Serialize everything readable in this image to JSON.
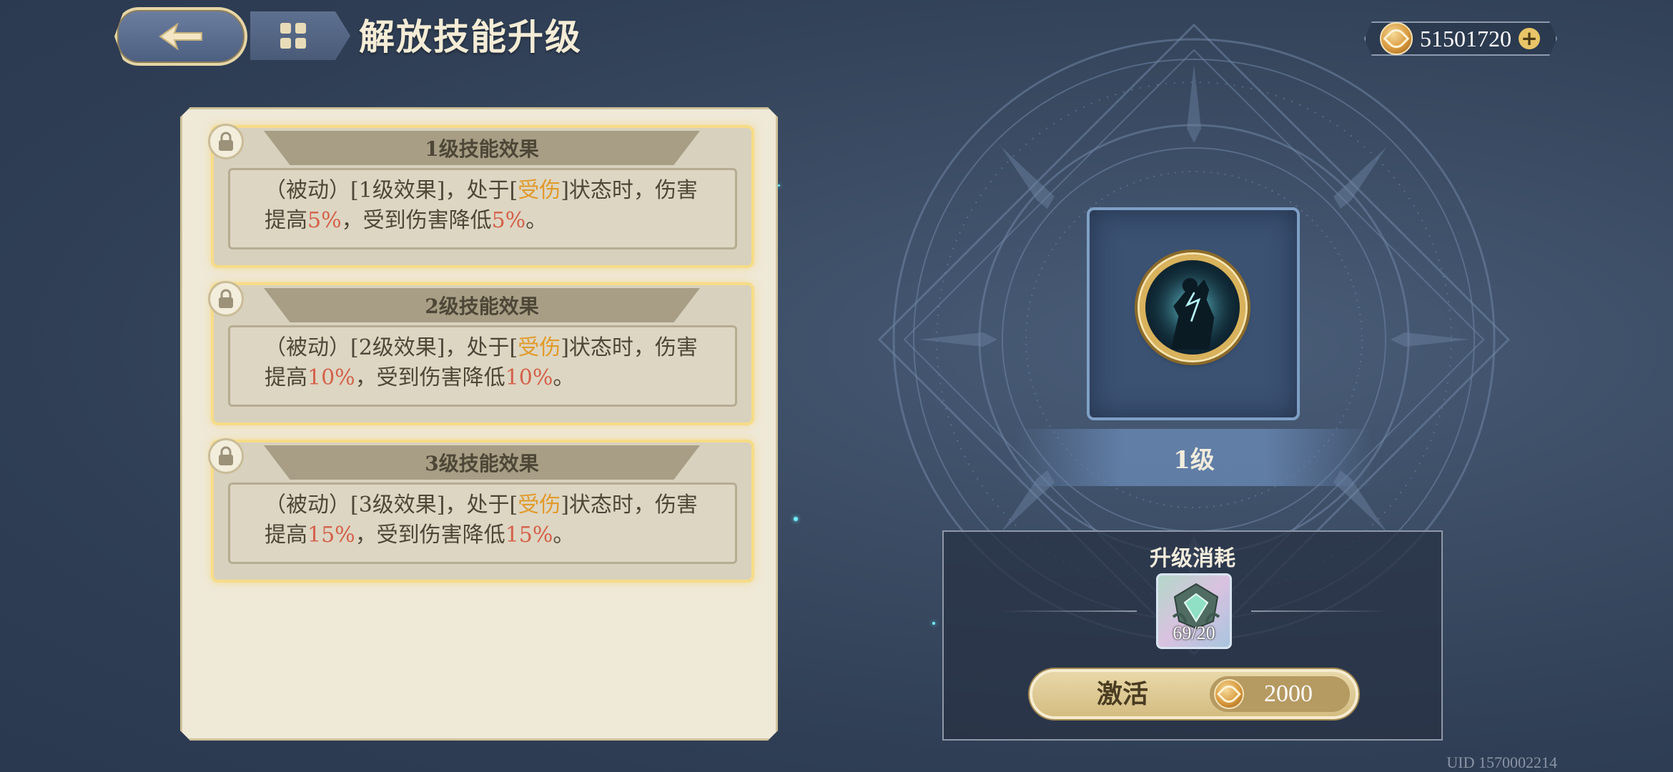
{
  "header": {
    "title": "解放技能升级",
    "currency_value": "51501720"
  },
  "skills": [
    {
      "title": "1级技能效果",
      "desc_prefix": "（被动）[1级效果]，处于[",
      "status": "受伤",
      "desc_mid": "]状态时，伤害提高",
      "dmg_up": "5%",
      "desc_mid2": "，受到伤害降低",
      "dmg_down": "5%",
      "desc_end": "。"
    },
    {
      "title": "2级技能效果",
      "desc_prefix": "（被动）[2级效果]，处于[",
      "status": "受伤",
      "desc_mid": "]状态时，伤害提高",
      "dmg_up": "10%",
      "desc_mid2": "，受到伤害降低",
      "dmg_down": "10%",
      "desc_end": "。"
    },
    {
      "title": "3级技能效果",
      "desc_prefix": "（被动）[3级效果]，处于[",
      "status": "受伤",
      "desc_mid": "]状态时，伤害提高",
      "dmg_up": "15%",
      "desc_mid2": "，受到伤害降低",
      "dmg_down": "15%",
      "desc_end": "。"
    }
  ],
  "current_level": "1级",
  "cost": {
    "title": "升级消耗",
    "item_count": "69/20",
    "activate_label": "激活",
    "price": "2000"
  },
  "footer": {
    "uid": "UID 1570002214"
  },
  "colors": {
    "highlight_status": "#e19a2a",
    "highlight_value": "#d4614a",
    "card_glow": "#f6dc87"
  },
  "icons": [
    "back-arrow-icon",
    "menu-grid-icon",
    "coin-icon",
    "plus-icon",
    "lock-icon",
    "skill-portrait-icon",
    "upgrade-material-icon"
  ]
}
